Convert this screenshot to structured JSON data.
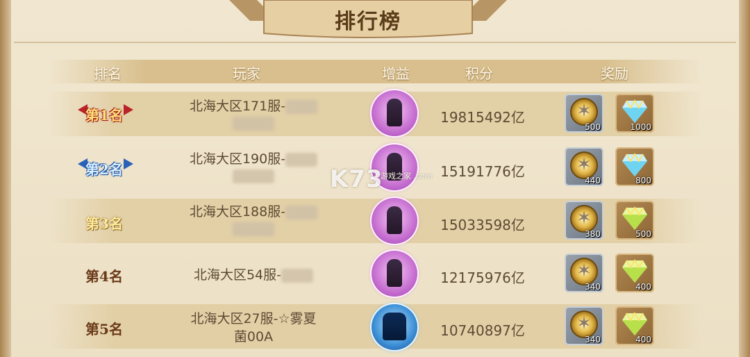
{
  "title": "排行榜",
  "headers": {
    "rank": "排名",
    "player": "玩家",
    "buff": "增益",
    "score": "积分",
    "reward": "奖励"
  },
  "rows": [
    {
      "rank_label": "第1名",
      "player_line1": "北海大区171服-",
      "score": "19815492亿",
      "medal_count": "500",
      "gem_count": "1000",
      "buff_icon": "purple-warrior-icon"
    },
    {
      "rank_label": "第2名",
      "player_line1": "北海大区190服-",
      "score": "15191776亿",
      "medal_count": "440",
      "gem_count": "800",
      "buff_icon": "purple-warrior-icon"
    },
    {
      "rank_label": "第3名",
      "player_line1": "北海大区188服-",
      "score": "15033598亿",
      "medal_count": "380",
      "gem_count": "500",
      "buff_icon": "purple-warrior-icon"
    },
    {
      "rank_label": "第4名",
      "player_line1": "北海大区54服-",
      "score": "12175976亿",
      "medal_count": "340",
      "gem_count": "400",
      "buff_icon": "purple-warrior-icon"
    },
    {
      "rank_label": "第5名",
      "player_line1": "北海大区27服-☆雾夏",
      "player_line2": "菌00A",
      "score": "10740897亿",
      "medal_count": "340",
      "gem_count": "400",
      "buff_icon": "blue-winged-icon"
    }
  ],
  "watermark": {
    "main": "K73",
    "sub": "游戏之家 .com"
  },
  "colors": {
    "accent_gold": "#e4b94a",
    "text_brown": "#5d4a33",
    "header_band": "#d8bf8d"
  }
}
